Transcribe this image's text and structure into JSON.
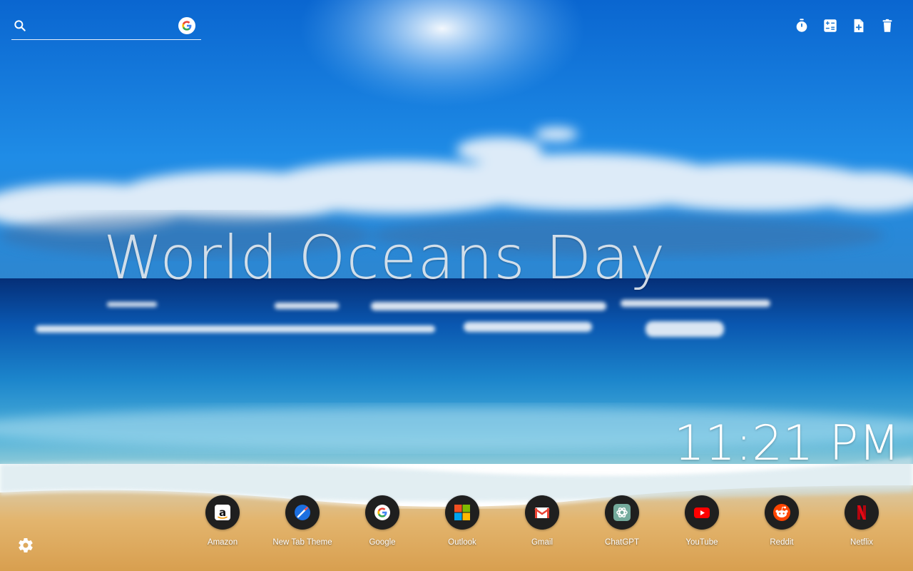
{
  "search": {
    "value": "",
    "placeholder": ""
  },
  "toolbar": {
    "icons": [
      "timer-icon",
      "calculator-icon",
      "new-note-icon",
      "trash-icon"
    ]
  },
  "background": {
    "headline": "World Oceans Day"
  },
  "clock": {
    "time": "11:21 PM"
  },
  "shortcuts": [
    {
      "label": "Amazon",
      "icon": "amazon-icon"
    },
    {
      "label": "New Tab Theme",
      "icon": "new-tab-theme-icon"
    },
    {
      "label": "Google",
      "icon": "google-icon"
    },
    {
      "label": "Outlook",
      "icon": "microsoft-icon"
    },
    {
      "label": "Gmail",
      "icon": "gmail-icon"
    },
    {
      "label": "ChatGPT",
      "icon": "chatgpt-icon"
    },
    {
      "label": "YouTube",
      "icon": "youtube-icon"
    },
    {
      "label": "Reddit",
      "icon": "reddit-icon"
    },
    {
      "label": "Netflix",
      "icon": "netflix-icon"
    }
  ],
  "colors": {
    "sky_top": "#0a6fd6",
    "sky_mid": "#1f8ce6",
    "sea_deep": "#063f8c",
    "sea_shallow": "#2f9fd6",
    "sand": "#e2b874",
    "icon_circle": "#1f1f1f"
  }
}
